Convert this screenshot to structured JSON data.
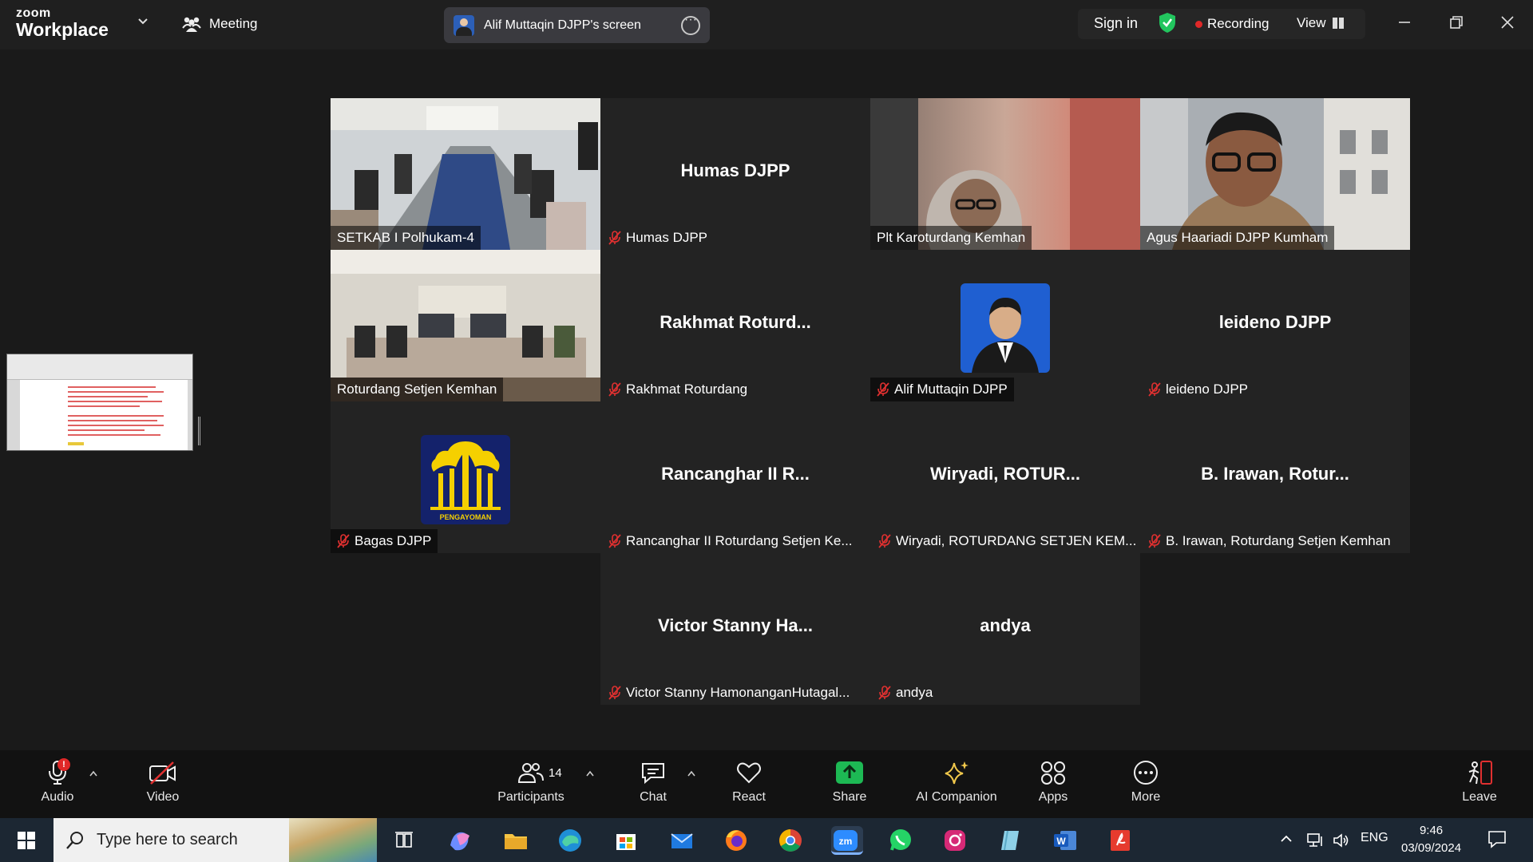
{
  "app": {
    "brand_small": "zoom",
    "brand_large": "Workplace"
  },
  "meeting_label": "Meeting",
  "share_pill": {
    "label": "Alif Muttaqin DJPP's screen"
  },
  "header_right": {
    "sign_in": "Sign in",
    "recording": "Recording",
    "view": "View"
  },
  "tiles": [
    {
      "name": "SETKAB I Polhukam-4",
      "big": "",
      "type": "video-room",
      "muted": false,
      "active": false
    },
    {
      "name": "Humas DJPP",
      "big": "Humas DJPP",
      "type": "name",
      "muted": true,
      "active": false
    },
    {
      "name": "Plt Karoturdang Kemhan",
      "big": "",
      "type": "video-person-hijab",
      "muted": false,
      "active": false
    },
    {
      "name": "Agus Haariadi DJPP Kumham",
      "big": "",
      "type": "video-person-building",
      "muted": false,
      "active": true
    },
    {
      "name": "Roturdang Setjen Kemhan",
      "big": "",
      "type": "video-room2",
      "muted": false,
      "active": false
    },
    {
      "name": "Rakhmat Roturdang",
      "big": "Rakhmat  Roturd...",
      "type": "name",
      "muted": true,
      "active": false
    },
    {
      "name": "Alif Muttaqin DJPP",
      "big": "",
      "type": "avatar-photo",
      "muted": true,
      "active": false
    },
    {
      "name": "leideno DJPP",
      "big": "leideno DJPP",
      "type": "name",
      "muted": true,
      "active": false
    },
    {
      "name": "Bagas DJPP",
      "big": "",
      "type": "avatar-logo",
      "logo_text": "PENGAYOMAN",
      "muted": true,
      "active": false
    },
    {
      "name": "Rancanghar II Roturdang Setjen Ke...",
      "big": "Rancanghar II R...",
      "type": "name",
      "muted": true,
      "active": false
    },
    {
      "name": "Wiryadi, ROTURDANG SETJEN KEM...",
      "big": "Wiryadi,  ROTUR...",
      "type": "name",
      "muted": true,
      "active": false
    },
    {
      "name": "B. Irawan, Roturdang Setjen Kemhan",
      "big": "B. Irawan,  Rotur...",
      "type": "name",
      "muted": true,
      "active": false
    },
    {
      "name": "Victor Stanny HamonanganHutagal...",
      "big": "Victor Stanny Ha...",
      "type": "name",
      "muted": true,
      "active": false
    },
    {
      "name": "andya",
      "big": "andya",
      "type": "name",
      "muted": true,
      "active": false
    }
  ],
  "toolbar": {
    "audio": "Audio",
    "video": "Video",
    "participants": "Participants",
    "participants_count": "14",
    "chat": "Chat",
    "react": "React",
    "share": "Share",
    "ai_companion": "AI Companion",
    "apps": "Apps",
    "more": "More",
    "leave": "Leave",
    "audio_badge": "!"
  },
  "taskbar": {
    "search_placeholder": "Type here to search",
    "language": "ENG",
    "time": "9:46",
    "date": "03/09/2024"
  },
  "colors": {
    "active_speaker": "#3ad16a",
    "share_green": "#1db954",
    "recording_dot": "#e02828",
    "mute_red": "#e03030",
    "taskbar_bg": "#1c2733"
  }
}
